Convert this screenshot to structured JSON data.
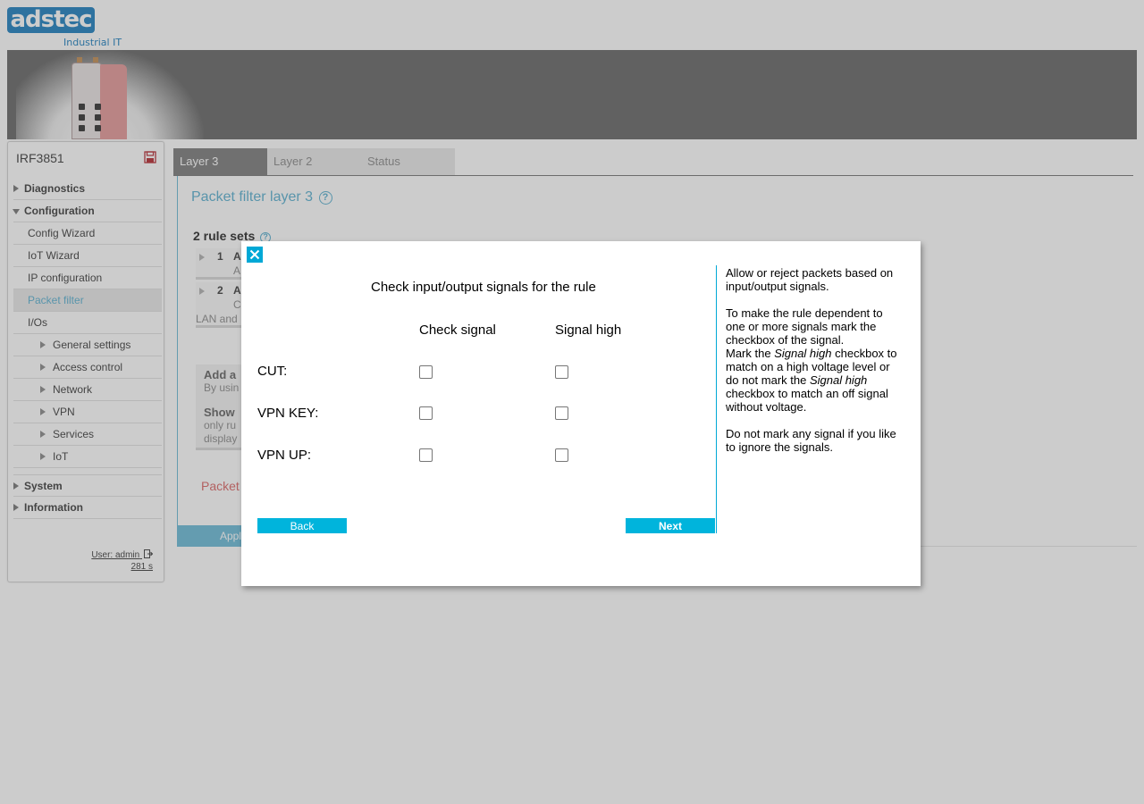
{
  "header": {
    "logo_text": "adstec",
    "logo_subtitle": "Industrial IT"
  },
  "sidebar": {
    "device_name": "IRF3851",
    "items": [
      {
        "label": "Diagnostics",
        "level": 0,
        "expanded": false
      },
      {
        "label": "Configuration",
        "level": 0,
        "expanded": true
      },
      {
        "label": "Config Wizard",
        "level": 1
      },
      {
        "label": "IoT Wizard",
        "level": 1
      },
      {
        "label": "IP configuration",
        "level": 1
      },
      {
        "label": "Packet filter",
        "level": 1,
        "active": true
      },
      {
        "label": "I/Os",
        "level": 1
      },
      {
        "label": "General settings",
        "level": 2
      },
      {
        "label": "Access control",
        "level": 2
      },
      {
        "label": "Network",
        "level": 2
      },
      {
        "label": "VPN",
        "level": 2
      },
      {
        "label": "Services",
        "level": 2
      },
      {
        "label": "IoT",
        "level": 2
      },
      {
        "label": "System",
        "level": 0,
        "expanded": false
      },
      {
        "label": "Information",
        "level": 0,
        "expanded": false
      }
    ],
    "user_label": "User: admin",
    "session_timer": "281 s"
  },
  "tabs": [
    {
      "label": "Layer 3",
      "active": true
    },
    {
      "label": "Layer 2",
      "active": false
    },
    {
      "label": "Status",
      "active": false
    }
  ],
  "main": {
    "title": "Packet filter layer 3",
    "ruleset_header": "2 rule sets",
    "rules": [
      {
        "num": "1",
        "name": "A",
        "desc": "A"
      },
      {
        "num": "2",
        "name": "A",
        "desc": "C",
        "extra": "LAN and"
      }
    ],
    "add_box": {
      "title": "Add a",
      "desc": "By usin"
    },
    "show_box": {
      "title": "Show",
      "desc1": "only ru",
      "desc2": "display"
    },
    "packet_link": "Packet",
    "apply_label": "Appl"
  },
  "dialog": {
    "title": "Check input/output signals for the rule",
    "col_check": "Check signal",
    "col_high": "Signal high",
    "signals": [
      {
        "label": "CUT:",
        "check": false,
        "high": false
      },
      {
        "label": "VPN KEY:",
        "check": false,
        "high": false
      },
      {
        "label": "VPN UP:",
        "check": false,
        "high": false
      }
    ],
    "back_label": "Back",
    "next_label": "Next",
    "help": {
      "p1": "Allow or reject packets based on input/output signals.",
      "p2a": "To make the rule dependent to one or more signals mark the checkbox of the signal.",
      "p2b_1": "Mark the ",
      "p2b_em1": "Signal high",
      "p2b_2": " checkbox to match on a high voltage level or do not mark the ",
      "p2b_em2": "Signal high",
      "p2b_3": " checkbox to match an off signal without voltage.",
      "p3": "Do not mark any signal if you like to ignore the signals."
    }
  },
  "colors": {
    "accent": "#00b4dc",
    "link": "#6fbad6",
    "banner": "#7a7a7a"
  }
}
